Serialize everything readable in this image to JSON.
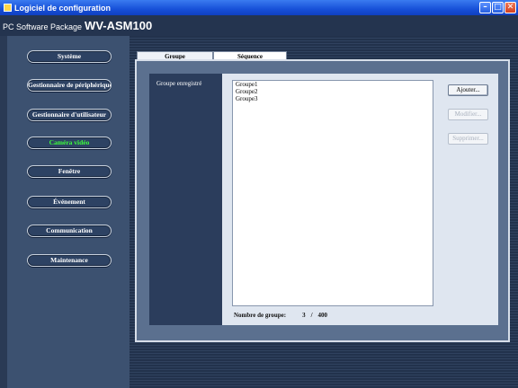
{
  "window": {
    "title": "Logiciel de configuration",
    "buttons": {
      "minimize": "–",
      "maximize": "□",
      "close": "✕"
    }
  },
  "header": {
    "package": "PC Software Package",
    "model": "WV-ASM100"
  },
  "sidebar": {
    "items": [
      {
        "label": "Système"
      },
      {
        "label": "Gestionnaire de périphérique"
      },
      {
        "label": "Gestionnaire d'utilisateur"
      },
      {
        "label": "Caméra vidéo",
        "active": true
      },
      {
        "label": "Fenêtre"
      },
      {
        "label": "Événement"
      },
      {
        "label": "Communication"
      },
      {
        "label": "Maintenance"
      }
    ]
  },
  "tabs": [
    {
      "label": "Groupe",
      "active": true
    },
    {
      "label": "Séquence"
    }
  ],
  "group_panel": {
    "label": "Groupe enregistré",
    "groups": [
      "Groupe1",
      "Groupe2",
      "Groupe3"
    ],
    "buttons": {
      "add": "Ajouter...",
      "modify": "Modifier...",
      "delete": "Supprimer..."
    },
    "count_label": "Nombre de groupe:",
    "count_current": "3",
    "count_separator": "/",
    "count_max": "400"
  },
  "colors": {
    "active_nav": "#3cff3c",
    "titlebar": "#1750d8"
  }
}
